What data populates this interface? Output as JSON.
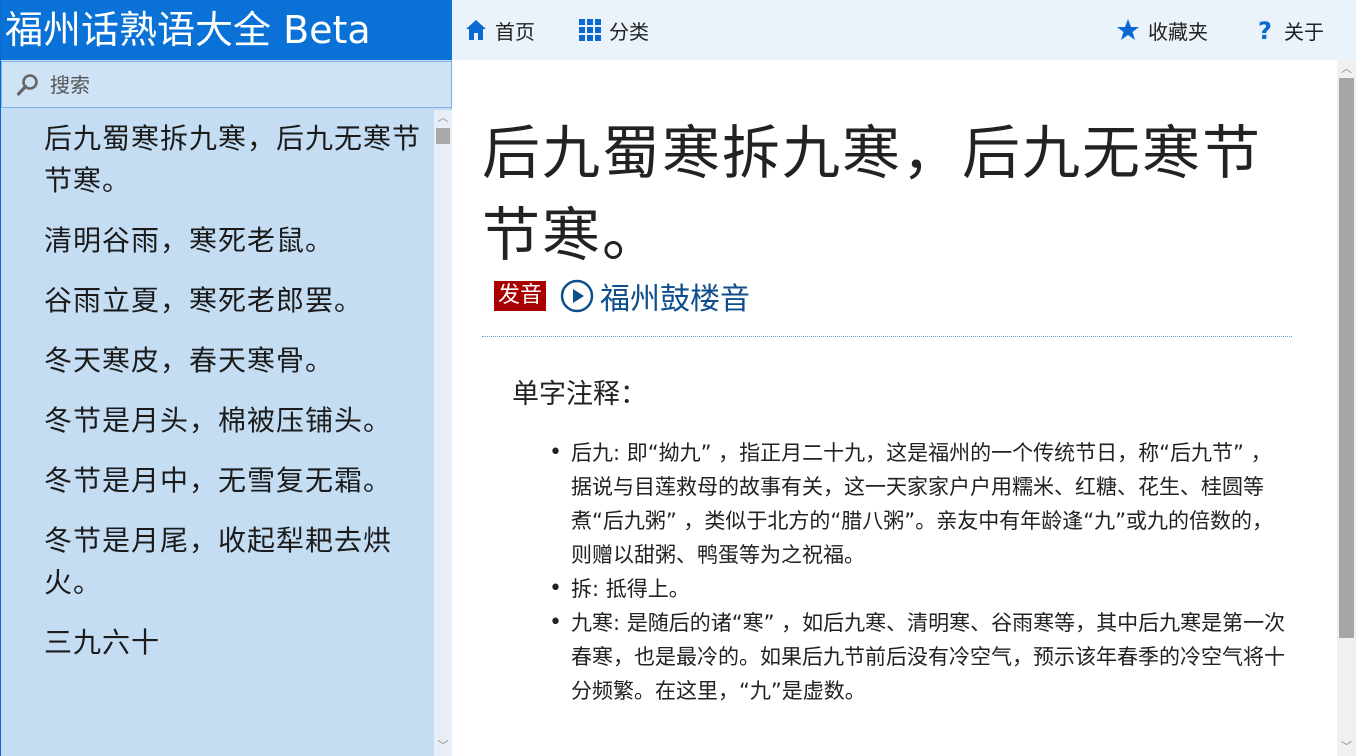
{
  "app": {
    "title": "福州话熟语大全 Beta"
  },
  "search": {
    "placeholder": "搜索"
  },
  "nav": {
    "home": "首页",
    "category": "分类",
    "favorites": "收藏夹",
    "about": "关于"
  },
  "sidebar": {
    "items": [
      "后九蜀寒拆九寒，后九无寒节节寒。",
      "清明谷雨，寒死老鼠。",
      "谷雨立夏，寒死老郎罢。",
      "冬天寒皮，春天寒骨。",
      "冬节是月头，棉被压铺头。",
      "冬节是月中，无雪复无霜。",
      "冬节是月尾，收起犁耙去烘火。",
      "三九六十"
    ]
  },
  "entry": {
    "title": "后九蜀寒拆九寒，后九无寒节节寒。",
    "pron_badge": "发音",
    "pron_link": "福州鼓楼音",
    "section_heading": "单字注释：",
    "notes": [
      "后九: 即“拗九” ，指正月二十九，这是福州的一个传统节日，称“后九节” ，据说与目莲救母的故事有关，这一天家家户户用糯米、红糖、花生、桂圆等煮“后九粥” ，类似于北方的“腊八粥”。亲友中有年龄逢“九”或九的倍数的，则赠以甜粥、鸭蛋等为之祝福。",
      "拆: 抵得上。",
      "九寒: 是随后的诸“寒” ，如后九寒、清明寒、谷雨寒等，其中后九寒是第一次春寒，也是最冷的。如果后九节前后没有冷空气，预示该年春季的冷空气将十分频繁。在这里，“九”是虚数。"
    ]
  },
  "colors": {
    "title_bar": "#0a72d6",
    "sidebar_bg": "#c5ddf3",
    "nav_bg": "#eaf2fa",
    "badge": "#a80000",
    "link": "#0f4e8c",
    "icon_blue": "#0a6ad1"
  },
  "icons": {
    "search": "search-icon",
    "home": "home-icon",
    "category": "grid-icon",
    "favorites": "star-icon",
    "about": "question-icon",
    "play": "play-icon"
  }
}
